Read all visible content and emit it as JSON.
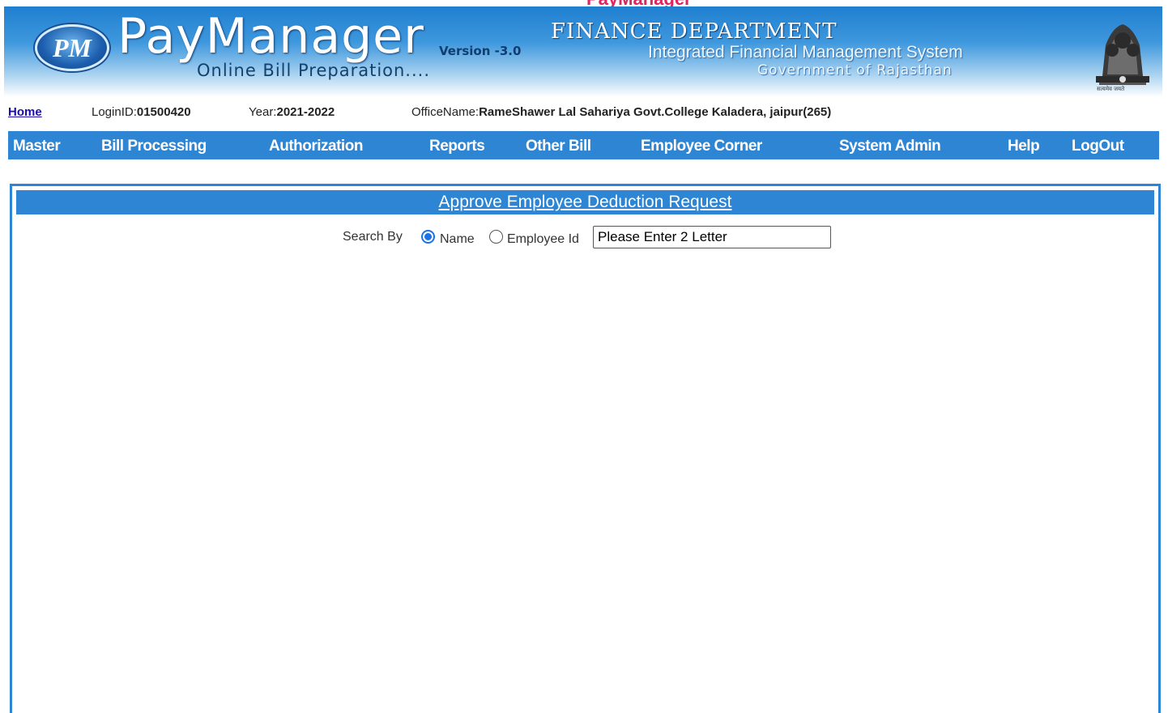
{
  "header": {
    "top_strip_text": "PayManager",
    "logo_letters": "PM",
    "brand": "PayManager",
    "version": "Version -3.0",
    "tagline": "Online Bill Preparation....",
    "department": "FINANCE  DEPARTMENT",
    "system_name": "Integrated Financial Management System",
    "government": "Government of Rajasthan",
    "emblem_caption": "सत्यमेव जयते"
  },
  "info": {
    "home_label": "Home",
    "login_label": "LoginID:",
    "login_value": "01500420",
    "year_label": "Year:",
    "year_value": "2021-2022",
    "office_label": "OfficeName:",
    "office_value": "RameShawer Lal Sahariya Govt.College Kaladera, jaipur(265)"
  },
  "menu": {
    "items": [
      {
        "label": "Master"
      },
      {
        "label": "Bill Processing"
      },
      {
        "label": "Authorization"
      },
      {
        "label": "Reports"
      },
      {
        "label": "Other Bill"
      },
      {
        "label": "Employee Corner"
      },
      {
        "label": "System Admin"
      },
      {
        "label": "Help"
      },
      {
        "label": "LogOut"
      }
    ]
  },
  "panel": {
    "title": "Approve Employee Deduction Request",
    "search_by_label": "Search By",
    "option_name": "Name",
    "option_employee_id": "Employee Id",
    "selected_option": "Name",
    "search_value": "Please Enter 2 Letter"
  },
  "colors": {
    "menu_bg": "#2e85d3",
    "link": "#1a0dab",
    "radio_accent": "#1a73e8"
  }
}
